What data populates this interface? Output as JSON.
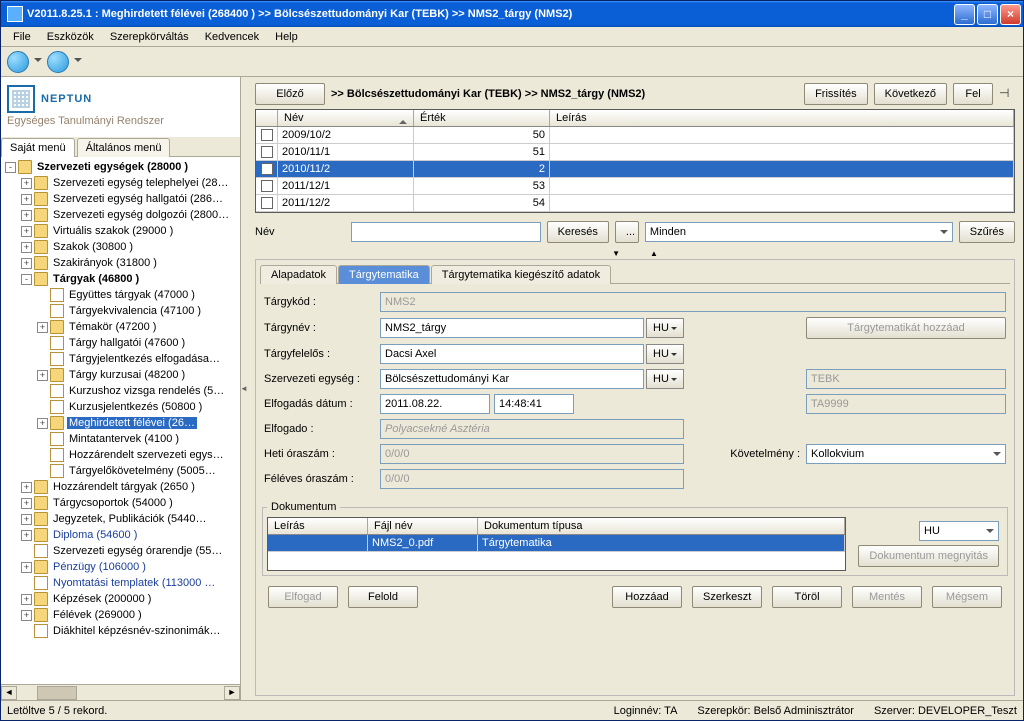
{
  "window_title": "V2011.8.25.1 : Meghirdetett félévei (268400  )  >> Bölcsészettudományi Kar (TEBK) >> NMS2_tárgy (NMS2)",
  "menubar": [
    "File",
    "Eszközök",
    "Szerepkörváltás",
    "Kedvencek",
    "Help"
  ],
  "logo": {
    "title": "NEPTUN",
    "subtitle": "Egységes Tanulmányi Rendszer"
  },
  "left_tabs": {
    "active": "Saját menü",
    "other": "Általános menü"
  },
  "tree": [
    {
      "ind": 0,
      "exp": "-",
      "ico": "fold",
      "label": "Szervezeti egységek (28000  )",
      "bold": true
    },
    {
      "ind": 1,
      "exp": "+",
      "ico": "fold",
      "label": "Szervezeti egység telephelyei (28…"
    },
    {
      "ind": 1,
      "exp": "+",
      "ico": "fold",
      "label": "Szervezeti egység hallgatói (286…"
    },
    {
      "ind": 1,
      "exp": "+",
      "ico": "fold",
      "label": "Szervezeti egység dolgozói (2800…"
    },
    {
      "ind": 1,
      "exp": "+",
      "ico": "fold",
      "label": "Virtuális szakok (29000  )"
    },
    {
      "ind": 1,
      "exp": "+",
      "ico": "fold",
      "label": "Szakok (30800  )"
    },
    {
      "ind": 1,
      "exp": "+",
      "ico": "fold",
      "label": "Szakirányok (31800  )"
    },
    {
      "ind": 1,
      "exp": "-",
      "ico": "fold",
      "label": "Tárgyak (46800  )",
      "bold": true
    },
    {
      "ind": 2,
      "exp": " ",
      "ico": "doc",
      "label": "Együttes tárgyak (47000  )"
    },
    {
      "ind": 2,
      "exp": " ",
      "ico": "doc",
      "label": "Tárgyekvivalencia (47100  )"
    },
    {
      "ind": 2,
      "exp": "+",
      "ico": "fold",
      "label": "Témakör (47200  )"
    },
    {
      "ind": 2,
      "exp": " ",
      "ico": "doc",
      "label": "Tárgy hallgatói (47600  )"
    },
    {
      "ind": 2,
      "exp": " ",
      "ico": "doc",
      "label": "Tárgyjelentkezés elfogadása…"
    },
    {
      "ind": 2,
      "exp": "+",
      "ico": "fold",
      "label": "Tárgy kurzusai (48200  )"
    },
    {
      "ind": 2,
      "exp": " ",
      "ico": "doc",
      "label": "Kurzushoz vizsga rendelés (5…"
    },
    {
      "ind": 2,
      "exp": " ",
      "ico": "doc",
      "label": "Kurzusjelentkezés (50800  )"
    },
    {
      "ind": 2,
      "exp": "+",
      "ico": "fold",
      "label": "Meghirdetett félévei (26…",
      "sel": true
    },
    {
      "ind": 2,
      "exp": " ",
      "ico": "doc",
      "label": "Mintatantervek (4100  )"
    },
    {
      "ind": 2,
      "exp": " ",
      "ico": "doc",
      "label": "Hozzárendelt szervezeti egys…"
    },
    {
      "ind": 2,
      "exp": " ",
      "ico": "doc",
      "label": "Tárgyelőkövetelmény (5005…"
    },
    {
      "ind": 1,
      "exp": "+",
      "ico": "fold",
      "label": "Hozzárendelt tárgyak (2650  )"
    },
    {
      "ind": 1,
      "exp": "+",
      "ico": "fold",
      "label": "Tárgycsoportok (54000  )"
    },
    {
      "ind": 1,
      "exp": "+",
      "ico": "fold",
      "label": "Jegyzetek, Publikációk (5440…"
    },
    {
      "ind": 1,
      "exp": "+",
      "ico": "fold",
      "label": "Diploma (54600  )",
      "blue": true
    },
    {
      "ind": 1,
      "exp": " ",
      "ico": "doc",
      "label": "Szervezeti egység órarendje (55…"
    },
    {
      "ind": 1,
      "exp": "+",
      "ico": "fold",
      "label": "Pénzügy (106000  )",
      "blue": true
    },
    {
      "ind": 1,
      "exp": " ",
      "ico": "doc",
      "label": "Nyomtatási templatek (113000  …",
      "blue": true
    },
    {
      "ind": 1,
      "exp": "+",
      "ico": "fold",
      "label": "Képzések (200000  )"
    },
    {
      "ind": 1,
      "exp": "+",
      "ico": "fold",
      "label": "Félévek (269000  )"
    },
    {
      "ind": 1,
      "exp": " ",
      "ico": "doc",
      "label": "Diákhitel képzésnév-szinonimák…"
    }
  ],
  "rtop": {
    "prev_btn": "Előző",
    "breadcrumb": ">>  Bölcsészettudományi Kar (TEBK) >> NMS2_tárgy (NMS2)",
    "refresh": "Frissítés",
    "next": "Következő",
    "up": "Fel"
  },
  "grid": {
    "headers": {
      "chk": "",
      "name": "Név",
      "value": "Érték",
      "desc": "Leírás"
    },
    "rows": [
      {
        "name": "2009/10/2",
        "value": "50",
        "desc": ""
      },
      {
        "name": "2010/11/1",
        "value": "51",
        "desc": ""
      },
      {
        "name": "2010/11/2",
        "value": "2",
        "desc": "",
        "sel": true
      },
      {
        "name": "2011/12/1",
        "value": "53",
        "desc": ""
      },
      {
        "name": "2011/12/2",
        "value": "54",
        "desc": ""
      }
    ]
  },
  "search": {
    "label": "Név",
    "btn": "Keresés",
    "dots": "...",
    "filter": "Minden",
    "filter_btn": "Szűrés"
  },
  "detail_tabs": [
    "Alapadatok",
    "Tárgytematika",
    "Tárgytematika kiegészítő adatok"
  ],
  "detail_active": 1,
  "form": {
    "targykod_l": "Tárgykód :",
    "targykod": "NMS2",
    "targynev_l": "Tárgynév :",
    "targynev": "NMS2_tárgy",
    "targyfelelos_l": "Tárgyfelelős :",
    "targyfelelos": "Dacsi Axel",
    "szervegy_l": "Szervezeti egység :",
    "szervegy": "Bölcsészettudományi Kar",
    "szervegy_code": "TEBK",
    "elfdatum_l": "Elfogadás dátum :",
    "elfdatum": "2011.08.22.",
    "elftime": "14:48:41",
    "elfogado_l": "Elfogado :",
    "elfogado": "Polyacsekné Asztéria",
    "ta": "TA9999",
    "hetiora_l": "Heti óraszám :",
    "hetiora": "0/0/0",
    "kovetelmeny_l": "Követelmény :",
    "kovetelmeny": "Kollokvium",
    "feleves_l": "Féléves óraszám :",
    "feleves": "0/0/0",
    "lang": "HU",
    "add_btn": "Tárgytematikát hozzáad"
  },
  "doc": {
    "legend": "Dokumentum",
    "headers": {
      "desc": "Leírás",
      "file": "Fájl név",
      "type": "Dokumentum típusa"
    },
    "row": {
      "desc": "",
      "file": "NMS2_0.pdf",
      "type": "Tárgytematika"
    },
    "lang": "HU",
    "open": "Dokumentum megnyitás"
  },
  "bottom_btns": {
    "elfogad": "Elfogad",
    "felold": "Felold",
    "hozzaad": "Hozzáad",
    "szerkeszt": "Szerkeszt",
    "torol": "Töröl",
    "mentes": "Mentés",
    "megsem": "Mégsem"
  },
  "status": {
    "left": "Letöltve 5 / 5 rekord.",
    "login": "Loginnév: TA",
    "role": "Szerepkör: Belső Adminisztrátor",
    "server": "Szerver: DEVELOPER_Teszt"
  }
}
